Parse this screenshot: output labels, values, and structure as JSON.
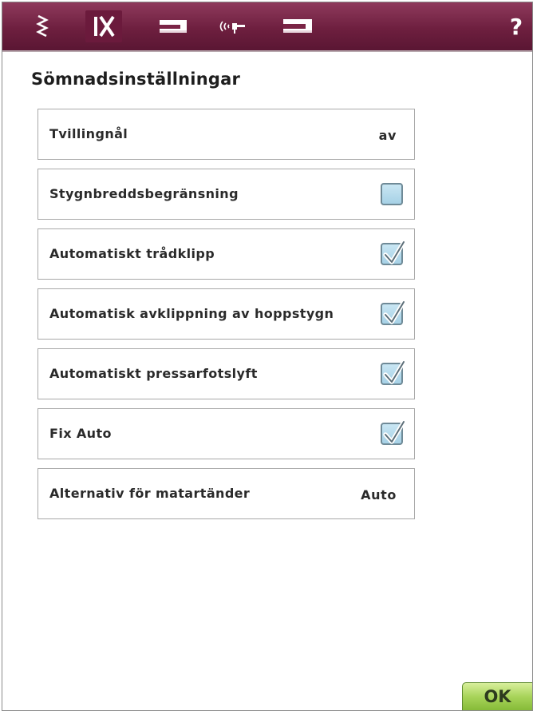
{
  "colors": {
    "topbar": "#6e1f3f",
    "topbar_selected": "#6b1a3c",
    "ok_button": "#a8d45a",
    "checkbox_fill": "#b8dcee"
  },
  "tabs": [
    {
      "icon": "zigzag-stitch-icon",
      "selected": false
    },
    {
      "icon": "stitch-settings-icon",
      "selected": true
    },
    {
      "icon": "sewing-machine-icon",
      "selected": false
    },
    {
      "icon": "wireless-connection-icon",
      "selected": false
    },
    {
      "icon": "embroidery-machine-icon",
      "selected": false
    },
    {
      "icon": "help-icon",
      "label": "?",
      "selected": false
    }
  ],
  "page": {
    "title": "Sömnadsinställningar"
  },
  "settings": [
    {
      "label": "Tvillingnål",
      "type": "value",
      "value": "av"
    },
    {
      "label": "Stygnbreddsbegränsning",
      "type": "checkbox",
      "checked": false
    },
    {
      "label": "Automatiskt trådklipp",
      "type": "checkbox",
      "checked": true
    },
    {
      "label": "Automatisk avklippning av hoppstygn",
      "type": "checkbox",
      "checked": true
    },
    {
      "label": "Automatiskt pressarfotslyft",
      "type": "checkbox",
      "checked": true
    },
    {
      "label": "Fix Auto",
      "type": "checkbox",
      "checked": true
    },
    {
      "label": "Alternativ för matartänder",
      "type": "value",
      "value": "Auto"
    }
  ],
  "ok_button": {
    "label": "OK"
  }
}
